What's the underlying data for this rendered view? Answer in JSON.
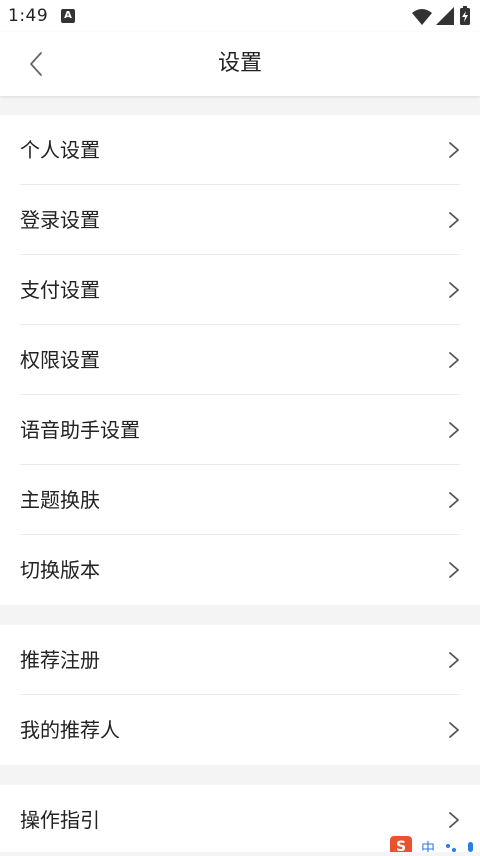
{
  "status_bar": {
    "time": "1:49",
    "notification_badge": "A",
    "icons": [
      "wifi-icon",
      "signal-icon",
      "battery-charging-icon"
    ]
  },
  "header": {
    "title": "设置",
    "back_icon": "chevron-left-icon"
  },
  "groups": [
    {
      "items": [
        {
          "label": "个人设置"
        },
        {
          "label": "登录设置"
        },
        {
          "label": "支付设置"
        },
        {
          "label": "权限设置"
        },
        {
          "label": "语音助手设置"
        },
        {
          "label": "主题换肤"
        },
        {
          "label": "切换版本"
        }
      ]
    },
    {
      "items": [
        {
          "label": "推荐注册"
        },
        {
          "label": "我的推荐人"
        }
      ]
    },
    {
      "items": [
        {
          "label": "操作指引"
        }
      ]
    }
  ],
  "colors": {
    "background": "#f4f4f4",
    "surface": "#ffffff",
    "text": "#222222",
    "chevron": "#555555",
    "divider": "#ebebeb",
    "ime_accent": "#e8532e",
    "ime_blue": "#2a7de1"
  },
  "ime_indicator": {
    "logo_letter": "S",
    "mode_char": "中",
    "icons": [
      "sogou-logo-icon",
      "dots-icon",
      "mic-icon"
    ]
  }
}
